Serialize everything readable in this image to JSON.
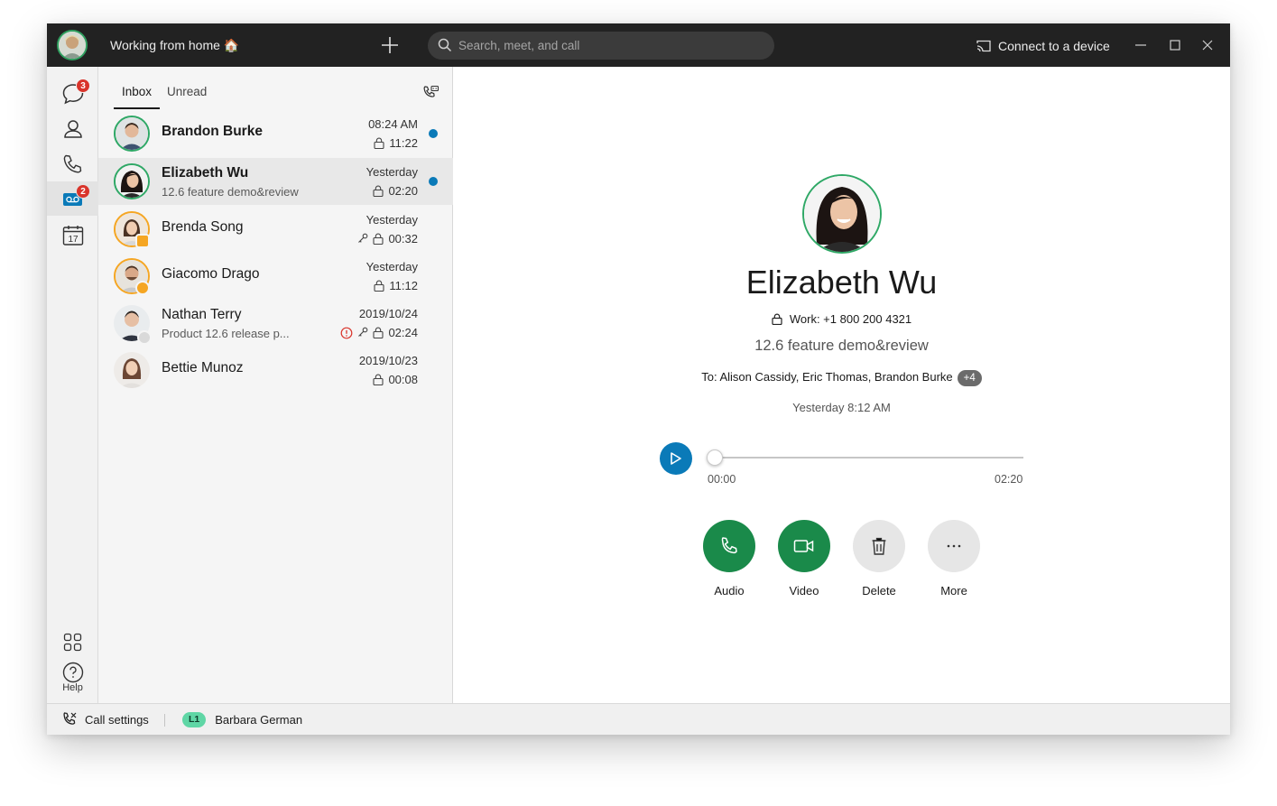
{
  "titlebar": {
    "status_text": "Working from home 🏠",
    "search_placeholder": "Search, meet, and call",
    "connect_label": "Connect to a device"
  },
  "rail": {
    "items": [
      {
        "icon": "chat-bubble-icon",
        "badge": "3"
      },
      {
        "icon": "contacts-icon"
      },
      {
        "icon": "phone-icon"
      },
      {
        "icon": "voicemail-icon",
        "badge": "2",
        "active": true
      },
      {
        "icon": "calendar-icon",
        "text": "17"
      }
    ],
    "apps_icon": "apps-grid-icon",
    "help_label": "Help"
  },
  "inbox": {
    "tabs": [
      {
        "label": "Inbox",
        "active": true
      },
      {
        "label": "Unread"
      }
    ],
    "filter_icon": "voicemail-filter-icon",
    "items": [
      {
        "name": "Brandon Burke",
        "subtitle": "",
        "time": "08:24 AM",
        "duration": "11:22",
        "bold": true,
        "unread": true
      },
      {
        "name": "Elizabeth Wu",
        "subtitle": "12.6 feature demo&review",
        "time": "Yesterday",
        "duration": "02:20",
        "bold": true,
        "unread": true,
        "selected": true
      },
      {
        "name": "Brenda Song",
        "subtitle": "",
        "time": "Yesterday",
        "duration": "00:32",
        "key": true
      },
      {
        "name": "Giacomo Drago",
        "subtitle": "",
        "time": "Yesterday",
        "duration": "11:12"
      },
      {
        "name": "Nathan Terry",
        "subtitle": "Product 12.6 release p...",
        "time": "2019/10/24",
        "duration": "02:24",
        "key": true,
        "urgent": true
      },
      {
        "name": "Bettie Munoz",
        "subtitle": "",
        "time": "2019/10/23",
        "duration": "00:08"
      }
    ]
  },
  "detail": {
    "name": "Elizabeth Wu",
    "work_phone": "Work: +1 800 200 4321",
    "subject": "12.6 feature demo&review",
    "to_prefix": "To: Alison Cassidy, Eric Thomas, Brandon Burke",
    "to_more": "+4",
    "when": "Yesterday 8:12 AM",
    "player": {
      "current": "00:00",
      "total": "02:20",
      "progress": 0.0
    },
    "actions": [
      {
        "label": "Audio",
        "icon": "phone-icon",
        "color": "#1a8a4a"
      },
      {
        "label": "Video",
        "icon": "video-camera-icon",
        "color": "#1a8a4a"
      },
      {
        "label": "Delete",
        "icon": "trash-icon",
        "color": "#e6e6e6"
      },
      {
        "label": "More",
        "icon": "more-dots-icon",
        "color": "#e6e6e6"
      }
    ]
  },
  "statusbar": {
    "call_settings": "Call settings",
    "line_badge": "L1",
    "line_name": "Barbara German"
  },
  "colors": {
    "titlebar_bg": "#222222",
    "accent_blue": "#0a7ab8",
    "call_green": "#1a8a4a",
    "badge_red": "#d9342b",
    "presence_green": "#2fa866",
    "presence_orange": "#f5a623",
    "line_badge_green": "#5fd6a5"
  }
}
